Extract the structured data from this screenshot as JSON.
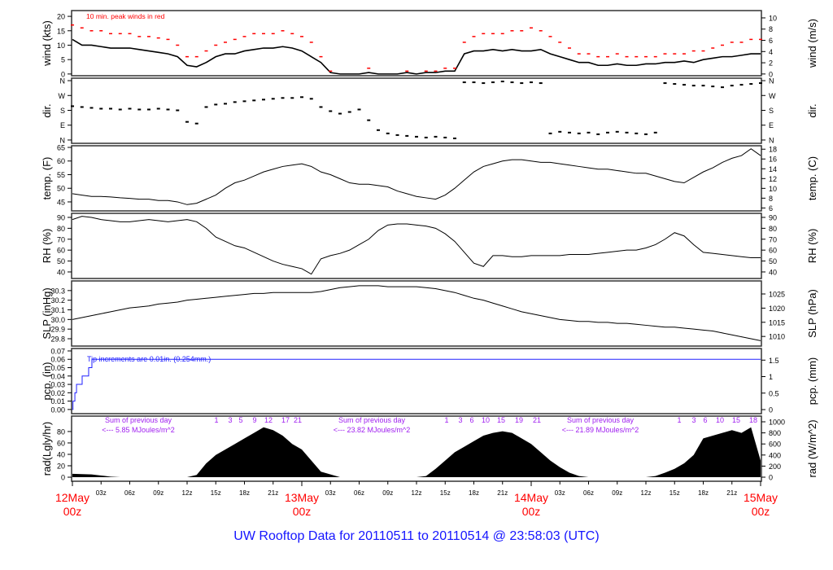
{
  "chart_data": {
    "type": "line",
    "title": "UW Rooftop Data for 20110511  to  20110514 @ 23:58:03  (UTC)",
    "x_unit": "hours since 12May 00z",
    "xlim": [
      0,
      72
    ],
    "day_labels": [
      "12May",
      "13May",
      "14May",
      "15May"
    ],
    "day_sublabel": "00z",
    "hour_labels": [
      "03z",
      "06z",
      "09z",
      "12z",
      "15z",
      "18z",
      "21z"
    ],
    "colors": {
      "line": "#000000",
      "peak": "#ff0000",
      "pcp": "#2020ff",
      "annotation": "#a020f0",
      "day_label": "#ff0000",
      "title": "#1515ff"
    },
    "panels": [
      {
        "id": "wind",
        "left_label": "wind (kts)",
        "right_label": "wind (m/s)",
        "ylim": [
          -0.6,
          22
        ],
        "right_ylim": [
          -0.31,
          11.3
        ],
        "left_ticks": [
          [
            0,
            "0"
          ],
          [
            5,
            "5"
          ],
          [
            10,
            "10"
          ],
          [
            15,
            "15"
          ],
          [
            20,
            "20"
          ]
        ],
        "right_ticks": [
          [
            0,
            "0"
          ],
          [
            2,
            "2"
          ],
          [
            4,
            "4"
          ],
          [
            6,
            "6"
          ],
          [
            8,
            "8"
          ],
          [
            10,
            "10"
          ]
        ],
        "annotation": "10 min. peak winds in red",
        "series": [
          {
            "name": "wind speed",
            "style": "line",
            "values": [
              12,
              10,
              10,
              9.5,
              9,
              9,
              9,
              8.5,
              8,
              7.5,
              7,
              6,
              3,
              2.5,
              4,
              6,
              7,
              7,
              8,
              8.5,
              9,
              9,
              9.5,
              9,
              8,
              6,
              4,
              0.5,
              0,
              0,
              0,
              0.5,
              0,
              0,
              0,
              0.5,
              0,
              0.5,
              0.5,
              1,
              1,
              7,
              8,
              8,
              8.5,
              8,
              8.5,
              8,
              8,
              8.5,
              7,
              6,
              5,
              4,
              4,
              3,
              3,
              3.5,
              3,
              3,
              3.5,
              3.5,
              4,
              4,
              4.5,
              4,
              5,
              5.5,
              6,
              6,
              6.5,
              7,
              7
            ]
          },
          {
            "name": "10 min peak",
            "style": "dash",
            "color": "peak",
            "values": [
              17,
              16,
              15,
              15,
              14,
              14,
              14,
              13,
              13,
              12.5,
              12,
              10,
              6,
              6,
              8,
              10,
              11,
              12,
              13,
              14,
              14,
              14,
              15,
              14,
              13,
              11,
              6,
              1,
              0,
              0,
              0,
              2,
              0,
              0,
              0,
              1,
              0,
              1,
              1,
              2,
              2,
              11,
              13,
              14,
              14,
              14,
              15,
              15,
              16,
              15,
              13,
              11,
              9,
              7,
              7,
              6,
              6,
              7,
              6,
              6,
              6,
              6,
              7,
              7,
              7,
              8,
              8,
              9,
              10,
              11,
              11,
              12,
              12
            ]
          }
        ]
      },
      {
        "id": "dir",
        "left_label": "dir.",
        "right_label": "dir.",
        "ylim": [
          -20,
          375
        ],
        "right_ylim": [
          -20,
          375
        ],
        "left_ticks": [
          [
            0,
            "N"
          ],
          [
            90,
            "E"
          ],
          [
            180,
            "S"
          ],
          [
            270,
            "W"
          ],
          [
            360,
            "N"
          ]
        ],
        "right_ticks": [
          [
            0,
            "N"
          ],
          [
            90,
            "E"
          ],
          [
            180,
            "S"
          ],
          [
            270,
            "W"
          ],
          [
            360,
            "N"
          ]
        ],
        "series": [
          {
            "name": "wind direction (deg)",
            "style": "dots",
            "values": [
              205,
              200,
              195,
              190,
              190,
              185,
              190,
              185,
              185,
              190,
              185,
              180,
              110,
              100,
              200,
              215,
              220,
              230,
              235,
              240,
              245,
              250,
              255,
              255,
              260,
              250,
              200,
              175,
              160,
              170,
              185,
              120,
              60,
              40,
              30,
              25,
              20,
              15,
              20,
              15,
              10,
              350,
              350,
              345,
              350,
              355,
              350,
              345,
              350,
              345,
              40,
              50,
              45,
              40,
              45,
              35,
              45,
              50,
              45,
              40,
              35,
              45,
              345,
              340,
              335,
              330,
              330,
              325,
              320,
              330,
              335,
              340,
              345
            ]
          }
        ]
      },
      {
        "id": "temp",
        "left_label": "temp. (F)",
        "right_label": "temp. (C)",
        "ylim": [
          41.7,
          65.6
        ],
        "right_ylim": [
          5.4,
          18.7
        ],
        "left_ticks": [
          [
            45,
            "45"
          ],
          [
            50,
            "50"
          ],
          [
            55,
            "55"
          ],
          [
            60,
            "60"
          ],
          [
            65,
            "65"
          ]
        ],
        "right_ticks": [
          [
            6,
            "6"
          ],
          [
            8,
            "8"
          ],
          [
            10,
            "10"
          ],
          [
            12,
            "12"
          ],
          [
            14,
            "14"
          ],
          [
            16,
            "16"
          ],
          [
            18,
            "18"
          ]
        ],
        "series": [
          {
            "name": "temperature (F)",
            "style": "line",
            "values": [
              48,
              47.5,
              47,
              47,
              46.8,
              46.5,
              46.3,
              46,
              46,
              45.5,
              45.5,
              45,
              44,
              44.5,
              46,
              47.5,
              50,
              52,
              53,
              54.5,
              56,
              57,
              58,
              58.5,
              59,
              58,
              56,
              55,
              53.5,
              52,
              51.5,
              51.5,
              51,
              50.5,
              49,
              48,
              47,
              46.5,
              46,
              47.5,
              50,
              53,
              56,
              58,
              59,
              60,
              60.5,
              60.5,
              60,
              59.5,
              59.5,
              59,
              58.5,
              58,
              57.5,
              57,
              57,
              56.5,
              56,
              55.5,
              55.5,
              54.5,
              53.5,
              52.5,
              52,
              54,
              56,
              57.5,
              59.5,
              61,
              62,
              64.5,
              62
            ]
          }
        ]
      },
      {
        "id": "rh",
        "left_label": "RH (%)",
        "right_label": "RH (%)",
        "ylim": [
          34,
          93.7
        ],
        "right_ylim": [
          34,
          93.7
        ],
        "left_ticks": [
          [
            40,
            "40"
          ],
          [
            50,
            "50"
          ],
          [
            60,
            "60"
          ],
          [
            70,
            "70"
          ],
          [
            80,
            "80"
          ],
          [
            90,
            "90"
          ]
        ],
        "right_ticks": [
          [
            40,
            "40"
          ],
          [
            50,
            "50"
          ],
          [
            60,
            "60"
          ],
          [
            70,
            "70"
          ],
          [
            80,
            "80"
          ],
          [
            90,
            "90"
          ]
        ],
        "series": [
          {
            "name": "relative humidity (%)",
            "style": "line",
            "values": [
              88,
              91,
              90,
              88,
              87,
              86,
              86,
              87,
              88,
              87,
              86,
              87,
              88,
              86,
              80,
              72,
              68,
              64,
              62,
              58,
              54,
              50,
              47,
              45,
              43,
              38,
              52,
              55,
              57,
              60,
              65,
              70,
              78,
              83,
              84,
              84,
              83,
              82,
              80,
              75,
              68,
              58,
              48,
              45,
              55,
              55,
              54,
              54,
              55,
              55,
              55,
              55,
              56,
              56,
              56,
              57,
              58,
              59,
              60,
              60,
              62,
              65,
              70,
              76,
              73,
              65,
              58,
              57,
              56,
              55,
              54,
              53,
              53
            ]
          }
        ]
      },
      {
        "id": "slp",
        "left_label": "SLP (inHg)",
        "right_label": "SLP (hPa)",
        "ylim": [
          29.724,
          30.4
        ],
        "right_ylim": [
          1006.6,
          1029.6
        ],
        "left_ticks": [
          [
            29.8,
            "29.8"
          ],
          [
            29.9,
            "29.9"
          ],
          [
            30.0,
            "30.0"
          ],
          [
            30.1,
            "30.1"
          ],
          [
            30.2,
            "30.2"
          ],
          [
            30.3,
            "30.3"
          ]
        ],
        "right_ticks": [
          [
            1010,
            "1010"
          ],
          [
            1015,
            "1015"
          ],
          [
            1020,
            "1020"
          ],
          [
            1025,
            "1025"
          ]
        ],
        "series": [
          {
            "name": "sea level pressure (inHg)",
            "style": "line",
            "values": [
              30.0,
              30.02,
              30.04,
              30.06,
              30.08,
              30.1,
              30.12,
              30.13,
              30.14,
              30.16,
              30.17,
              30.18,
              30.2,
              30.21,
              30.22,
              30.23,
              30.24,
              30.25,
              30.26,
              30.27,
              30.27,
              30.28,
              30.28,
              30.28,
              30.28,
              30.28,
              30.29,
              30.31,
              30.33,
              30.34,
              30.35,
              30.35,
              30.35,
              30.34,
              30.34,
              30.34,
              30.34,
              30.33,
              30.32,
              30.3,
              30.28,
              30.25,
              30.22,
              30.2,
              30.17,
              30.14,
              30.11,
              30.08,
              30.06,
              30.04,
              30.02,
              30.0,
              29.99,
              29.98,
              29.98,
              29.97,
              29.97,
              29.96,
              29.96,
              29.95,
              29.94,
              29.93,
              29.92,
              29.92,
              29.91,
              29.9,
              29.89,
              29.88,
              29.86,
              29.84,
              29.82,
              29.8,
              29.78
            ]
          }
        ]
      },
      {
        "id": "pcp",
        "left_label": "pcp. (in)",
        "right_label": "pcp. (mm)",
        "ylim": [
          -0.005,
          0.0729
        ],
        "right_ylim": [
          -0.123,
          1.852
        ],
        "left_ticks": [
          [
            0,
            "0.00"
          ],
          [
            0.01,
            "0.01"
          ],
          [
            0.02,
            "0.02"
          ],
          [
            0.03,
            "0.03"
          ],
          [
            0.04,
            "0.04"
          ],
          [
            0.05,
            "0.05"
          ],
          [
            0.06,
            "0.06"
          ],
          [
            0.07,
            "0.07"
          ]
        ],
        "right_ticks": [
          [
            0,
            "0"
          ],
          [
            0.5,
            "0.5"
          ],
          [
            1,
            "1"
          ],
          [
            1.5,
            "1.5"
          ]
        ],
        "annotation": "Tip increments are 0.01in. (0.254mm.)",
        "series": [
          {
            "name": "cumulative precipitation (in)",
            "style": "step",
            "color": "pcp",
            "points": [
              [
                0,
                0
              ],
              [
                0.06,
                0.01
              ],
              [
                0.26,
                0.02
              ],
              [
                0.43,
                0.03
              ],
              [
                1.02,
                0.04
              ],
              [
                1.7,
                0.05
              ],
              [
                2.04,
                0.06
              ],
              [
                72,
                0.06
              ]
            ]
          }
        ]
      },
      {
        "id": "rad",
        "left_label": "rad(Lgly/hr)",
        "right_label": "rad (W/m^2)",
        "ylim": [
          -7.1,
          107
        ],
        "right_ylim": [
          -73.5,
          1103
        ],
        "left_ticks": [
          [
            0,
            "0"
          ],
          [
            20,
            "20"
          ],
          [
            40,
            "40"
          ],
          [
            60,
            "60"
          ],
          [
            80,
            "80"
          ]
        ],
        "right_ticks": [
          [
            0,
            "0"
          ],
          [
            200,
            "200"
          ],
          [
            400,
            "400"
          ],
          [
            600,
            "600"
          ],
          [
            800,
            "800"
          ],
          [
            1000,
            "1000"
          ]
        ],
        "series": [
          {
            "name": "solar radiation (W/m^2)",
            "style": "area",
            "axis": "right",
            "values": [
              60,
              55,
              50,
              30,
              10,
              0,
              0,
              0,
              0,
              0,
              0,
              0,
              0,
              40,
              250,
              400,
              500,
              600,
              700,
              800,
              900,
              850,
              750,
              600,
              500,
              300,
              100,
              50,
              0,
              0,
              0,
              0,
              0,
              0,
              0,
              0,
              0,
              20,
              150,
              300,
              450,
              550,
              650,
              750,
              800,
              830,
              800,
              700,
              600,
              450,
              300,
              180,
              80,
              20,
              0,
              0,
              0,
              0,
              0,
              0,
              0,
              20,
              80,
              150,
              250,
              400,
              700,
              750,
              800,
              850,
              800,
              900,
              300
            ]
          }
        ],
        "daily_sums": [
          {
            "line1": "Sum of previous day",
            "line2": "<--- 5.85 MJoules/m^2",
            "hour_marks": [
              "1",
              "3",
              "5",
              "9",
              "12",
              "17",
              "21"
            ]
          },
          {
            "line1": "Sum of previous day",
            "line2": "<--- 23.82 MJoules/m^2",
            "hour_marks": [
              "1",
              "3",
              "6",
              "10",
              "15",
              "19",
              "21"
            ]
          },
          {
            "line1": "Sum of previous day",
            "line2": "<--- 21.89 MJoules/m^2",
            "hour_marks": [
              "1",
              "3",
              "6",
              "10",
              "15",
              "18"
            ]
          }
        ]
      }
    ]
  }
}
